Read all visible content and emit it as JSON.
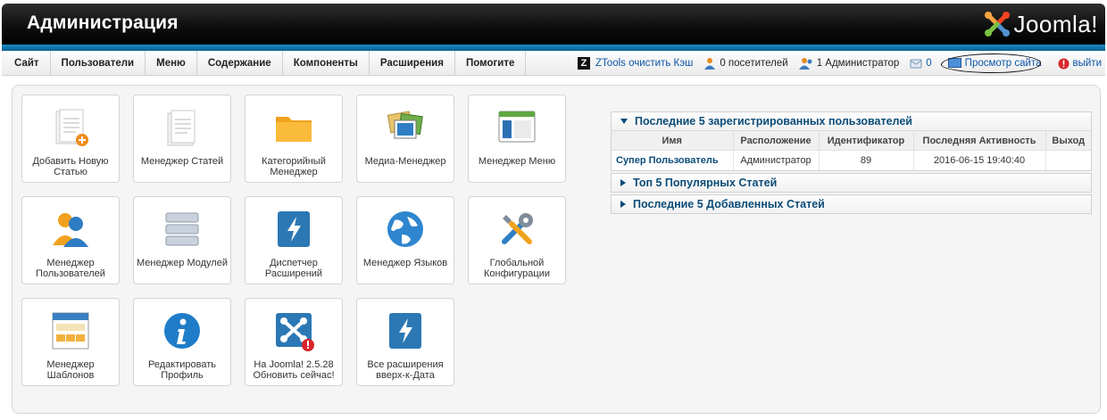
{
  "header": {
    "title": "Администрация",
    "logo_text": "Joomla!"
  },
  "menu": [
    "Сайт",
    "Пользователи",
    "Меню",
    "Содержание",
    "Компоненты",
    "Расширения",
    "Помогите"
  ],
  "status": {
    "ztools": "ZTools очистить Кэш",
    "visitors": "0 посетителей",
    "admins": "1 Администратор",
    "messages": "0",
    "preview": "Просмотр сайта",
    "logout": "выйти"
  },
  "icons": [
    {
      "label": "Добавить Новую Статью",
      "icon": "add-article-icon"
    },
    {
      "label": "Менеджер Статей",
      "icon": "article-manager-icon"
    },
    {
      "label": "Категорийный Менеджер",
      "icon": "folder-icon"
    },
    {
      "label": "Медиа-Менеджер",
      "icon": "media-icon"
    },
    {
      "label": "Менеджер Меню",
      "icon": "menu-manager-icon"
    },
    {
      "label": "Менеджер Пользователей",
      "icon": "users-icon"
    },
    {
      "label": "Менеджер Модулей",
      "icon": "modules-icon"
    },
    {
      "label": "Диспетчер Расширений",
      "icon": "extensions-icon"
    },
    {
      "label": "Менеджер Языков",
      "icon": "globe-icon"
    },
    {
      "label": "Глобальной Конфигурации",
      "icon": "tools-icon"
    },
    {
      "label": "Менеджер Шаблонов",
      "icon": "template-icon"
    },
    {
      "label": "Редактировать Профиль",
      "icon": "info-icon"
    },
    {
      "label": "На Joomla! 2.5.28 Обновить сейчас!",
      "icon": "joomla-update-icon"
    },
    {
      "label": "Все расширения вверх-к-Дата",
      "icon": "extensions-update-icon"
    }
  ],
  "modules": {
    "latest_users": {
      "title": "Последние 5 зарегистрированных пользователей",
      "columns": [
        "Имя",
        "Расположение",
        "Идентификатор",
        "Последняя Активность",
        "Выход"
      ],
      "rows": [
        [
          "Супер Пользователь",
          "Администратор",
          "89",
          "2016-06-15 19:40:40",
          ""
        ]
      ]
    },
    "popular": {
      "title": "Топ 5 Популярных Статей"
    },
    "latest_added": {
      "title": "Последние 5 Добавленных Статей"
    }
  },
  "colors": {
    "accent_blue": "#1a8dc6",
    "link": "#0b4c78",
    "header": "#111111"
  }
}
